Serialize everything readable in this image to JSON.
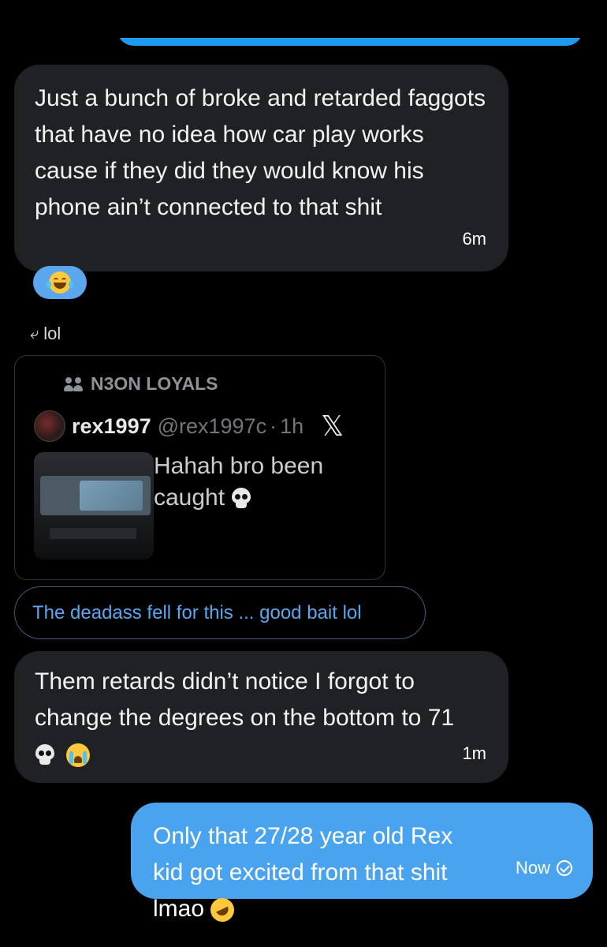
{
  "messages": {
    "msg1": {
      "text": "Just a bunch of broke and retarded faggots that have no idea how car play works cause if they did they would know his phone ain’t connected to that shit",
      "time": "6m"
    },
    "msg2": {
      "text": "Them retards didn’t notice I forgot to change the degrees on the bottom to 71",
      "time": "1m"
    },
    "msg3": {
      "text": "Only that 27/28 year old Rex kid got excited from that shit lmao",
      "time": "Now"
    }
  },
  "reaction": {
    "icon": "face-with-tears-of-joy-icon"
  },
  "reply": {
    "label": "lol"
  },
  "quote": {
    "community": "N3ON LOYALS",
    "author_name": "rex1997",
    "author_handle": "@rex1997c",
    "separator": "·",
    "time": "1h",
    "platform_logo": "𝕏",
    "text": "Hahah bro been caught"
  },
  "reply_chip": {
    "text": "The deadass fell for this ... good bait lol"
  },
  "colors": {
    "outgoing_bubble": "#4aa3ef",
    "incoming_bubble": "#1f2124",
    "background": "#000000",
    "link": "#5aa7ee"
  }
}
